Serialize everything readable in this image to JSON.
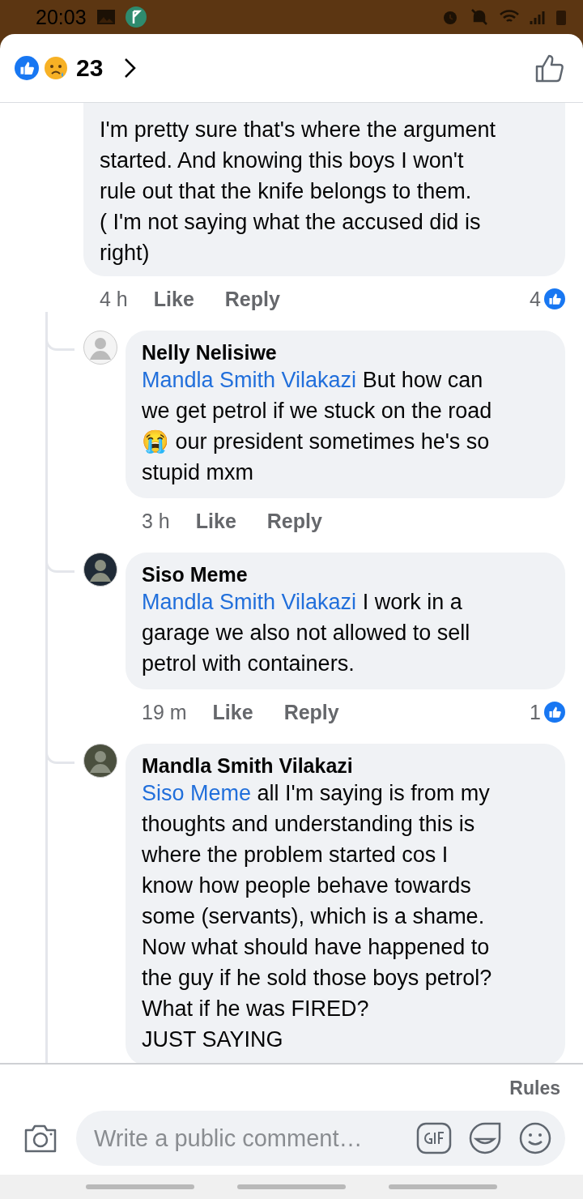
{
  "status_bar": {
    "time": "20:03"
  },
  "header": {
    "reaction_count": "23"
  },
  "comments": [
    {
      "kind": "cut",
      "text": "I'm pretty sure that's where the argument\nstarted. And knowing this boys I won't\nrule out that the knife belongs to them.\n( I'm not saying what the accused did is\nright)",
      "time": "4 h",
      "like_label": "Like",
      "reply_label": "Reply",
      "like_count": "4"
    },
    {
      "kind": "reply",
      "author": "Nelly Nelisiwe",
      "mention": "Mandla Smith Vilakazi",
      "text": " But how can\nwe get petrol if we stuck  on the road\n😭 our president sometimes he's so\nstupid mxm",
      "time": "3 h",
      "like_label": "Like",
      "reply_label": "Reply"
    },
    {
      "kind": "reply",
      "author": "Siso Meme",
      "mention": "Mandla Smith Vilakazi",
      "text": " I  work in a\ngarage we also not allowed to sell\npetrol with containers.",
      "time": "19 m",
      "like_label": "Like",
      "reply_label": "Reply",
      "like_count": "1"
    },
    {
      "kind": "reply",
      "author": "Mandla Smith Vilakazi",
      "mention": "Siso Meme",
      "text": " all I'm saying is from my\nthoughts and understanding this is\nwhere the problem started cos I\nknow how people behave towards\nsome (servants), which is a shame.\nNow what should have happened to\nthe guy if he sold those boys petrol?\nWhat if he was FIRED?\nJUST SAYING"
    }
  ],
  "composer": {
    "rules": "Rules",
    "placeholder": "Write a public comment…"
  }
}
